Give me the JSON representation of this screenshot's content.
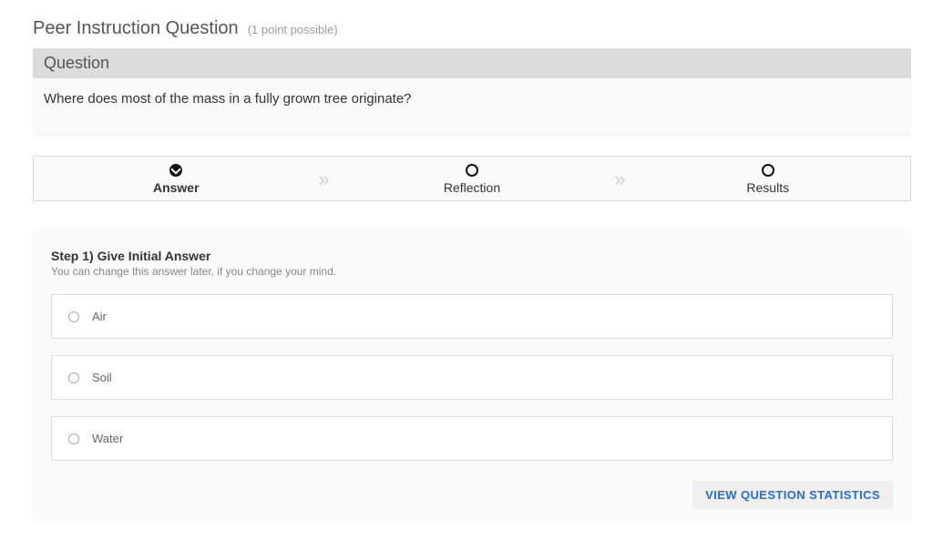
{
  "header": {
    "title": "Peer Instruction Question",
    "points": "(1 point possible)"
  },
  "question": {
    "section_label": "Question",
    "text": "Where does most of the mass in a fully grown tree originate?"
  },
  "steps": {
    "answer": "Answer",
    "reflection": "Reflection",
    "results": "Results"
  },
  "panel": {
    "step_title": "Step 1) Give Initial Answer",
    "step_sub": "You can change this answer later, if you change your mind.",
    "options": [
      "Air",
      "Soil",
      "Water"
    ]
  },
  "footer": {
    "view_stats": "VIEW QUESTION STATISTICS"
  }
}
